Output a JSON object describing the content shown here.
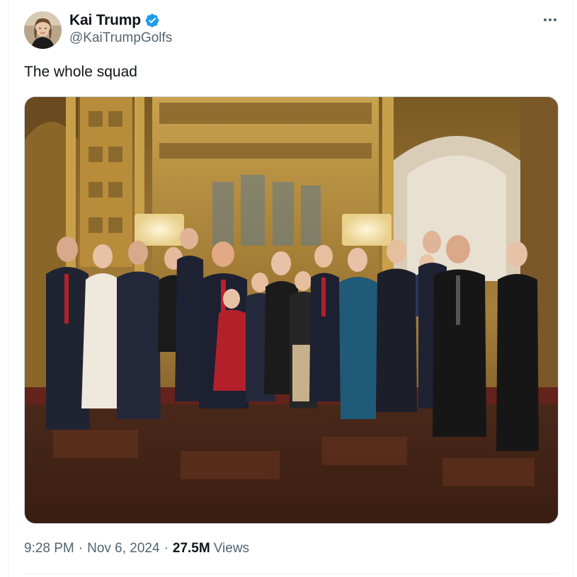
{
  "author": {
    "display_name": "Kai Trump",
    "handle": "@KaiTrumpGolfs",
    "verified": true,
    "verified_color": "#1d9bf0"
  },
  "tweet": {
    "text": "The whole squad",
    "time": "9:28 PM",
    "separator": "·",
    "date": "Nov 6, 2024",
    "views_count": "27.5M",
    "views_label": "Views"
  },
  "icons": {
    "more": "more-horizontal-icon",
    "verified": "verified-badge-icon"
  },
  "colors": {
    "text_primary": "#0f1419",
    "text_secondary": "#536471",
    "border": "#cfd9de"
  }
}
